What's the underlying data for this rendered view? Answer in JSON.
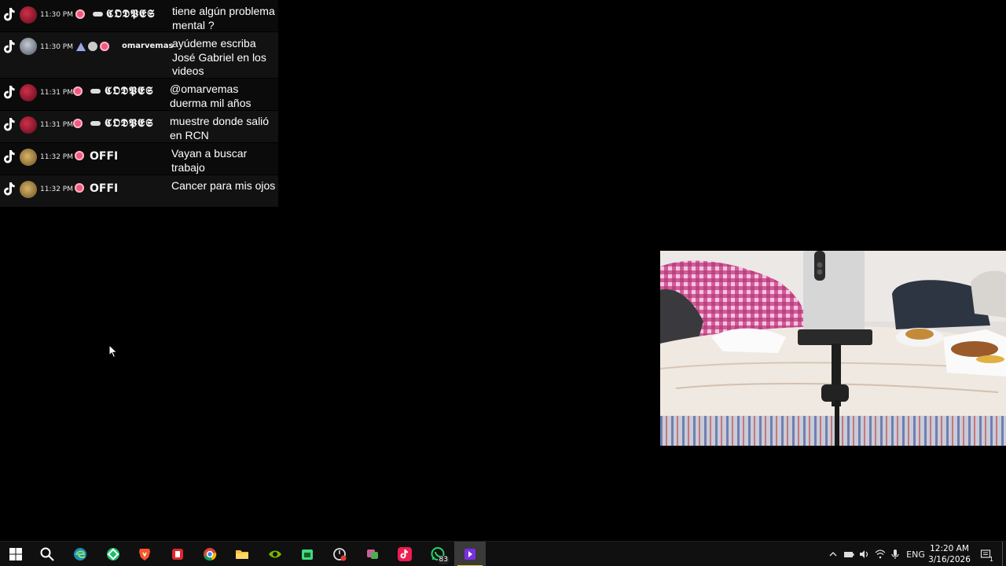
{
  "chat": {
    "messages": [
      {
        "time": "11:30 PM",
        "user": "𝕮𝕺𝕯𝕻𝕰𝕾",
        "text": "tiene algún problema mental ?",
        "avatar": "avatar-red"
      },
      {
        "time": "11:30 PM",
        "user": "omarvemas",
        "text": "ayúdeme escriba José Gabriel en los videos",
        "avatar": "avatar-gray"
      },
      {
        "time": "11:31 PM",
        "user": "𝕮𝕺𝕯𝕻𝕰𝕾",
        "text": "@omarvemas duerma mil años",
        "avatar": "avatar-red"
      },
      {
        "time": "11:31 PM",
        "user": "𝕮𝕺𝕯𝕻𝕰𝕾",
        "text": "muestre donde salió en RCN",
        "avatar": "avatar-red"
      },
      {
        "time": "11:32 PM",
        "user": "OFFI",
        "text": "Vayan a buscar trabajo",
        "avatar": "avatar-gold"
      },
      {
        "time": "11:32 PM",
        "user": "OFFI",
        "text": "Cancer para mis ojos",
        "avatar": "avatar-gold"
      }
    ]
  },
  "taskbar": {
    "apps": [
      "windows-start",
      "search",
      "edge",
      "gamebar",
      "brave",
      "red-app",
      "chrome",
      "file-explorer",
      "nvidia",
      "android",
      "clock-app",
      "snip-app",
      "tiktok",
      "whatsapp",
      "streamer-app"
    ],
    "whatsapp_badge": "83",
    "language": "ENG",
    "time": "12:20 AM",
    "date": "3/16/2026",
    "notification_count": "1"
  }
}
